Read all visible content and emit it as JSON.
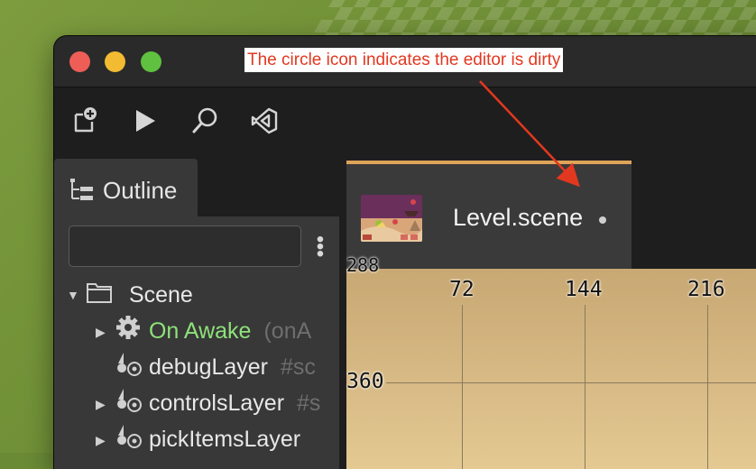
{
  "annotation": {
    "note_text": "The circle icon indicates the editor is dirty",
    "note_color": "#e2381f"
  },
  "window": {
    "traffic_lights": [
      "close",
      "minimize",
      "zoom"
    ]
  },
  "toolbar": {
    "icons": [
      "new-file-icon",
      "play-icon",
      "search-icon",
      "vscode-icon"
    ]
  },
  "outline": {
    "tab_label": "Outline",
    "search_value": "",
    "tree": [
      {
        "label": "Scene",
        "meta": "",
        "icon": "folder-icon",
        "expanded": true
      },
      {
        "label": "On Awake",
        "meta": "(onA",
        "icon": "gear-icon",
        "expanded": false,
        "color": "#8ee27a"
      },
      {
        "label": "debugLayer",
        "meta": "#sc",
        "icon": "layer-icon"
      },
      {
        "label": "controlsLayer",
        "meta": "#s",
        "icon": "layer-icon",
        "expanded": false
      },
      {
        "label": "pickItemsLayer",
        "meta": "",
        "icon": "layer-icon",
        "expanded": false
      }
    ]
  },
  "editor": {
    "tab_title": "Level.scene",
    "dirty_indicator": "•",
    "accent_color": "#e0a35a",
    "ruler": {
      "x_ticks": [
        "72",
        "144",
        "216"
      ],
      "y_ticks": [
        "360",
        "288"
      ]
    }
  }
}
